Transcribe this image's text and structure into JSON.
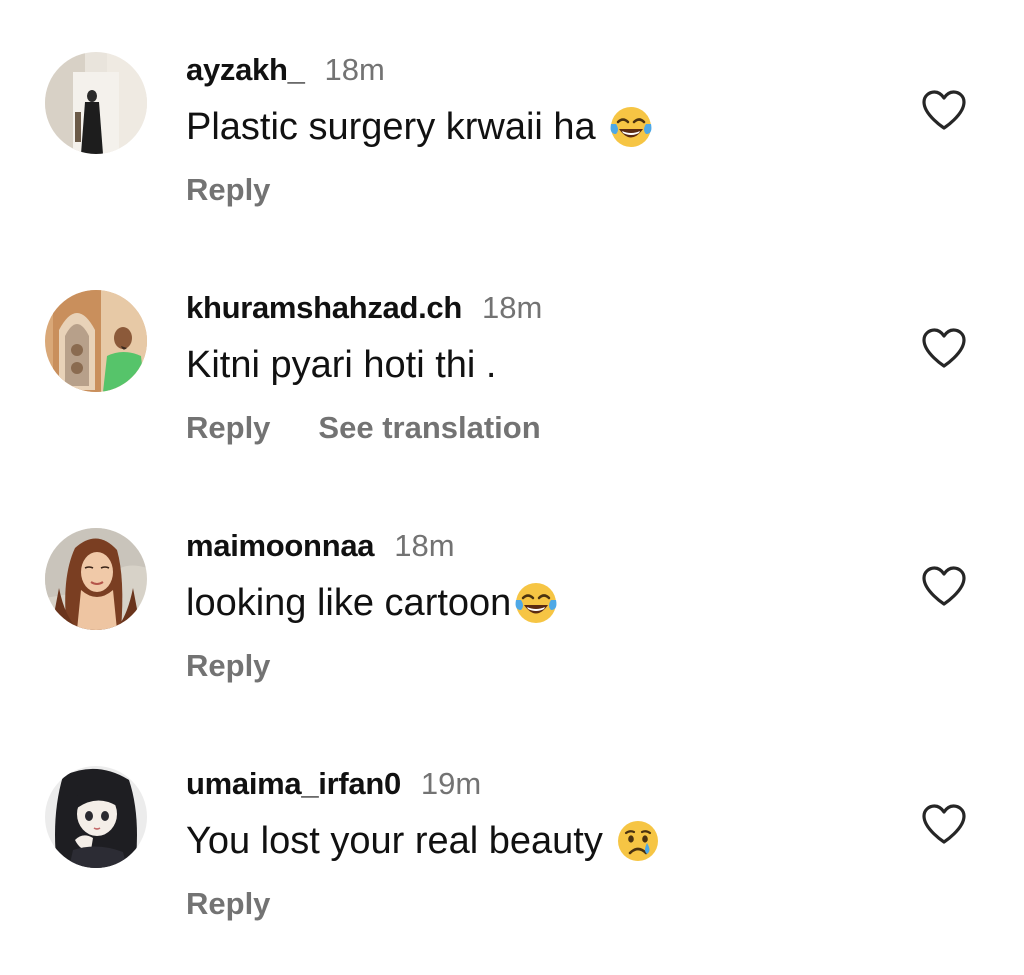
{
  "comments": [
    {
      "username": "ayzakh_",
      "time": "18m",
      "text": "Plastic surgery krwaii ha",
      "emoji": "face-with-tears-of-joy",
      "actions": [
        "Reply"
      ]
    },
    {
      "username": "khuramshahzad.ch",
      "time": "18m",
      "text": "Kitni pyari hoti thi .",
      "emoji": "",
      "actions": [
        "Reply",
        "See translation"
      ]
    },
    {
      "username": "maimoonnaa",
      "time": "18m",
      "text": "looking like cartoon",
      "emoji": "face-with-tears-of-joy",
      "actions": [
        "Reply"
      ]
    },
    {
      "username": "umaima_irfan0",
      "time": "19m",
      "text": "You lost your real beauty",
      "emoji": "crying-face",
      "actions": [
        "Reply"
      ]
    }
  ],
  "colors": {
    "primary_text": "#111111",
    "secondary_text": "#737373",
    "background": "#ffffff"
  }
}
